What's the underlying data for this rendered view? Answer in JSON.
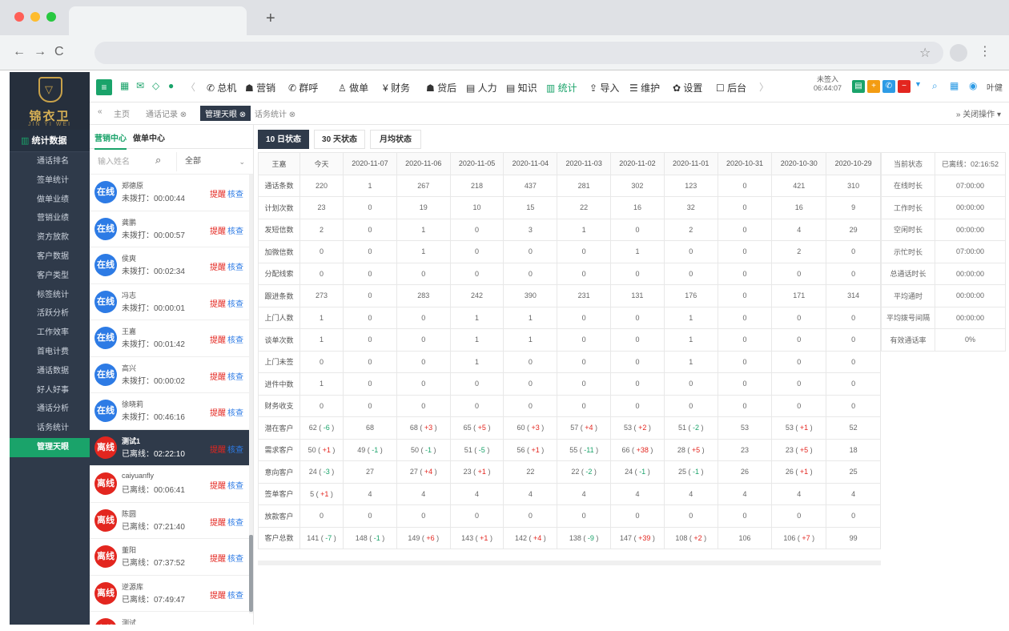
{
  "browser": {
    "new_tab": "+"
  },
  "sidebar": {
    "logo_text": "锦衣卫",
    "logo_sub": "JIN YI WEI",
    "section": "统计数据",
    "items": [
      "通话排名",
      "签单统计",
      "做单业绩",
      "营销业绩",
      "资方放款",
      "客户数据",
      "客户类型",
      "标签统计",
      "活跃分析",
      "工作效率",
      "首电计费",
      "通话数据",
      "好人好事",
      "通话分析",
      "话务统计",
      "管理天眼"
    ],
    "active_index": 15
  },
  "topnav": {
    "items": [
      "总机",
      "营销",
      "群呼",
      "做单",
      "财务",
      "贷后",
      "人力",
      "知识",
      "统计",
      "导入",
      "维护",
      "设置",
      "后台"
    ],
    "active": "统计",
    "clock_label": "未签入",
    "clock_time": "06:44:07",
    "user": "叶健"
  },
  "crumbs": {
    "home": "主页",
    "items": [
      "通话记录",
      "管理天眼",
      "话务统计"
    ],
    "active": "管理天眼",
    "close_ops": "关闭操作"
  },
  "list": {
    "tabs": [
      "营销中心",
      "做单中心"
    ],
    "active_tab": "营销中心",
    "search_placeholder": "输入姓名",
    "filter_value": "全部",
    "remind_label": "提醒",
    "review_label": "核查",
    "people": [
      {
        "name": "郑德原",
        "badge": "在线",
        "status": "未拨打：00:00:44",
        "type": "online"
      },
      {
        "name": "龚鹏",
        "badge": "在线",
        "status": "未拨打：00:00:57",
        "type": "online"
      },
      {
        "name": "侯爽",
        "badge": "在线",
        "status": "未拨打：00:02:34",
        "type": "online"
      },
      {
        "name": "冯志",
        "badge": "在线",
        "status": "未拨打：00:00:01",
        "type": "online"
      },
      {
        "name": "王嘉",
        "badge": "在线",
        "status": "未拨打：00:01:42",
        "type": "online"
      },
      {
        "name": "高兴",
        "badge": "在线",
        "status": "未拨打：00:00:02",
        "type": "online"
      },
      {
        "name": "徐晓莉",
        "badge": "在线",
        "status": "未拨打：00:46:16",
        "type": "online"
      },
      {
        "name": "测试1",
        "badge": "离线",
        "status": "已离线：02:22:10",
        "type": "offline",
        "highlight": true
      },
      {
        "name": "caiyuanfly",
        "badge": "离线",
        "status": "已离线：00:06:41",
        "type": "offline"
      },
      {
        "name": "陈圆",
        "badge": "离线",
        "status": "已离线：07:21:40",
        "type": "offline"
      },
      {
        "name": "董阳",
        "badge": "离线",
        "status": "已离线：07:37:52",
        "type": "offline"
      },
      {
        "name": "逆源库",
        "badge": "离线",
        "status": "已离线：07:49:47",
        "type": "offline"
      },
      {
        "name": "测试",
        "badge": "离线",
        "status": "",
        "type": "offline"
      }
    ]
  },
  "status_tabs": [
    "10 日状态",
    "30 天状态",
    "月均状态"
  ],
  "active_status_tab": "10 日状态",
  "table": {
    "headers": [
      "王嘉",
      "今天",
      "2020-11-07",
      "2020-11-06",
      "2020-11-05",
      "2020-11-04",
      "2020-11-03",
      "2020-11-02",
      "2020-11-01",
      "2020-10-31",
      "2020-10-30",
      "2020-10-29"
    ],
    "rows": [
      [
        "通话条数",
        "220",
        "1",
        "267",
        "218",
        "437",
        "281",
        "302",
        "123",
        "0",
        "421",
        "310"
      ],
      [
        "计划次数",
        "23",
        "0",
        "19",
        "10",
        "15",
        "22",
        "16",
        "32",
        "0",
        "16",
        "9"
      ],
      [
        "发短信数",
        "2",
        "0",
        "1",
        "0",
        "3",
        "1",
        "0",
        "2",
        "0",
        "4",
        "29"
      ],
      [
        "加微信数",
        "0",
        "0",
        "1",
        "0",
        "0",
        "0",
        "1",
        "0",
        "0",
        "2",
        "0"
      ],
      [
        "分配线索",
        "0",
        "0",
        "0",
        "0",
        "0",
        "0",
        "0",
        "0",
        "0",
        "0",
        "0"
      ],
      [
        "跟进条数",
        "273",
        "0",
        "283",
        "242",
        "390",
        "231",
        "131",
        "176",
        "0",
        "171",
        "314"
      ],
      [
        "上门人数",
        "1",
        "0",
        "0",
        "1",
        "1",
        "0",
        "0",
        "1",
        "0",
        "0",
        "0"
      ],
      [
        "谈单次数",
        "1",
        "0",
        "0",
        "1",
        "1",
        "0",
        "0",
        "1",
        "0",
        "0",
        "0"
      ],
      [
        "上门未签",
        "0",
        "0",
        "0",
        "1",
        "0",
        "0",
        "0",
        "1",
        "0",
        "0",
        "0"
      ],
      [
        "进件中数",
        "1",
        "0",
        "0",
        "0",
        "0",
        "0",
        "0",
        "0",
        "0",
        "0",
        "0"
      ],
      [
        "财务收支",
        "0",
        "0",
        "0",
        "0",
        "0",
        "0",
        "0",
        "0",
        "0",
        "0",
        "0"
      ],
      [
        "潜在客户",
        "62 ( -6 )",
        "68",
        "68 ( +3 )",
        "65 ( +5 )",
        "60 ( +3 )",
        "57 ( +4 )",
        "53 ( +2 )",
        "51 ( -2 )",
        "53",
        "53 ( +1 )",
        "52"
      ],
      [
        "需求客户",
        "50 ( +1 )",
        "49 ( -1 )",
        "50 ( -1 )",
        "51 ( -5 )",
        "56 ( +1 )",
        "55 ( -11 )",
        "66 ( +38 )",
        "28 ( +5 )",
        "23",
        "23 ( +5 )",
        "18"
      ],
      [
        "意向客户",
        "24 ( -3 )",
        "27",
        "27 ( +4 )",
        "23 ( +1 )",
        "22",
        "22 ( -2 )",
        "24 ( -1 )",
        "25 ( -1 )",
        "26",
        "26 ( +1 )",
        "25"
      ],
      [
        "签单客户",
        "5 ( +1 )",
        "4",
        "4",
        "4",
        "4",
        "4",
        "4",
        "4",
        "4",
        "4",
        "4"
      ],
      [
        "放款客户",
        "0",
        "0",
        "0",
        "0",
        "0",
        "0",
        "0",
        "0",
        "0",
        "0",
        "0"
      ],
      [
        "客户总数",
        "141 ( -7 )",
        "148 ( -1 )",
        "149 ( +6 )",
        "143 ( +1 )",
        "142 ( +4 )",
        "138 ( -9 )",
        "147 ( +39 )",
        "108 ( +2 )",
        "106",
        "106 ( +7 )",
        "99"
      ]
    ]
  },
  "side_status": [
    {
      "label": "当前状态",
      "value": "已离线：02:16:52",
      "color": "red"
    },
    {
      "label": "在线时长",
      "value": "07:00:00",
      "color": "blue"
    },
    {
      "label": "工作时长",
      "value": "00:00:00",
      "color": "green"
    },
    {
      "label": "空闲时长",
      "value": "00:00:00",
      "color": "red"
    },
    {
      "label": "示忙时长",
      "value": "07:00:00",
      "color": "red"
    },
    {
      "label": "总通话时长",
      "value": "00:00:00",
      "color": "gray"
    },
    {
      "label": "平均通时",
      "value": "00:00:00",
      "color": "gray"
    },
    {
      "label": "平均拨号间隔",
      "value": "00:00:00",
      "color": "gray"
    },
    {
      "label": "有效通话率",
      "value": "0%",
      "color": "red"
    }
  ]
}
